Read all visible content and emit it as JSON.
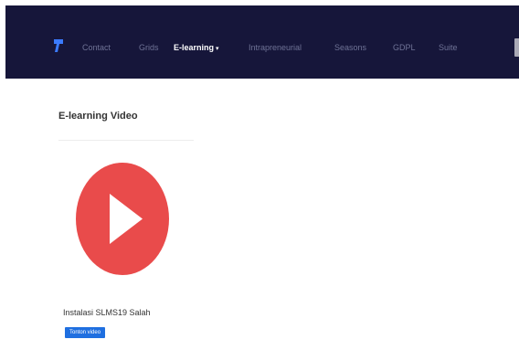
{
  "navbar": {
    "items": [
      {
        "label": "Contact"
      },
      {
        "label": "Grids"
      },
      {
        "label": "E-learning",
        "active": true,
        "has_caret": true
      },
      {
        "label": "Intrapreneurial"
      },
      {
        "label": "Seasons"
      },
      {
        "label": "GDPL"
      },
      {
        "label": "Suite"
      }
    ]
  },
  "main": {
    "title": "E-learning Video",
    "video": {
      "title": "Instalasi SLMS19 Salah",
      "button_label": "Tonton video"
    }
  },
  "colors": {
    "navbar_bg": "#16163a",
    "nav_text": "#6f7396",
    "nav_active": "#ffffff",
    "play_red": "#e94b4b",
    "button_blue": "#1f6fe0"
  },
  "icons": {
    "brand": "logo-icon",
    "caret": "chevron-down-icon",
    "play": "play-icon"
  }
}
